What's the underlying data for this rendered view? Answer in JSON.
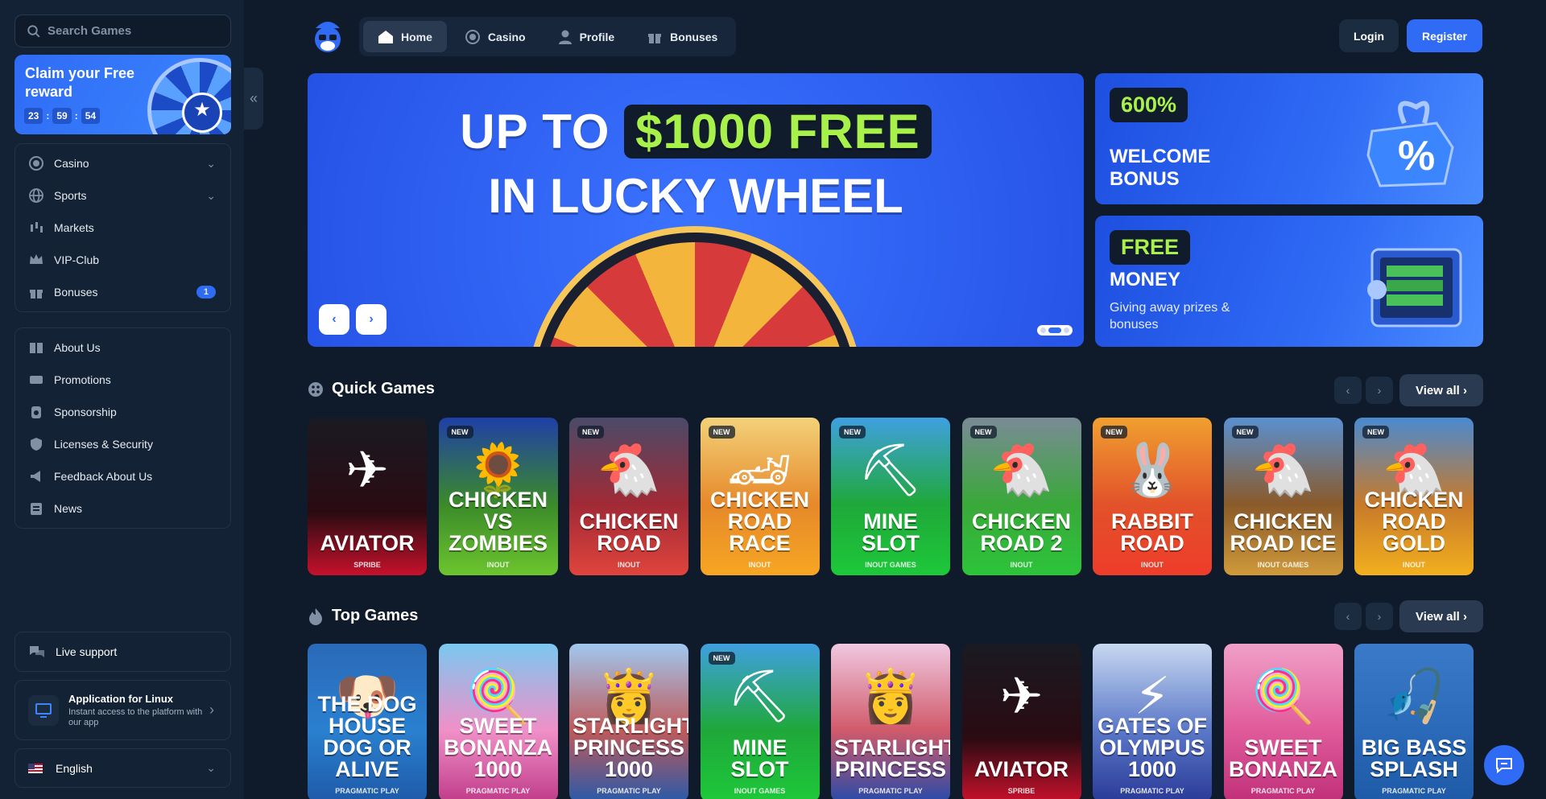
{
  "sidebar": {
    "search_placeholder": "Search Games",
    "claim": {
      "title": "Claim your Free reward",
      "hours": "23",
      "minutes": "59",
      "seconds": "54"
    },
    "nav": [
      {
        "label": "Casino",
        "icon": "casino-icon"
      },
      {
        "label": "Sports",
        "icon": "globe-icon"
      },
      {
        "label": "Markets",
        "icon": "candlestick-icon"
      },
      {
        "label": "VIP-Club",
        "icon": "crown-icon"
      },
      {
        "label": "Bonuses",
        "icon": "gift-icon",
        "badge": "1"
      }
    ],
    "info": [
      {
        "label": "About Us"
      },
      {
        "label": "Promotions"
      },
      {
        "label": "Sponsorship"
      },
      {
        "label": "Licenses & Security"
      },
      {
        "label": "Feedback About Us"
      },
      {
        "label": "News"
      }
    ],
    "live_support": "Live support",
    "app": {
      "title": "Application for Linux",
      "subtitle": "Instant access to the platform with our app"
    },
    "language": "English"
  },
  "header": {
    "tabs": [
      {
        "label": "Home",
        "active": true
      },
      {
        "label": "Casino"
      },
      {
        "label": "Profile"
      },
      {
        "label": "Bonuses"
      }
    ],
    "login": "Login",
    "register": "Register"
  },
  "hero": {
    "line1_prefix": "UP TO",
    "line1_highlight": "$1000 FREE",
    "line2": "IN LUCKY WHEEL",
    "prev": "‹",
    "next": "›"
  },
  "promos": [
    {
      "tag": "600%",
      "title": "WELCOME BONUS"
    },
    {
      "tag": "FREE",
      "title": "MONEY",
      "subtitle": "Giving away prizes & bonuses"
    }
  ],
  "quick_games": {
    "title": "Quick Games",
    "view_all": "View all",
    "games": [
      {
        "name": "AVIATOR",
        "provider": "SPRIBE",
        "new": false,
        "bg": "linear-gradient(180deg,#1a1a22,#2a0b12 60%,#c7112b)",
        "art": "✈"
      },
      {
        "name": "CHICKEN VS ZOMBIES",
        "provider": "INOUT",
        "new": true,
        "bg": "linear-gradient(180deg,#1f3fa8,#3b8a2a 55%,#6cc52e)",
        "art": "🌻"
      },
      {
        "name": "CHICKEN ROAD",
        "provider": "INOUT",
        "new": true,
        "bg": "linear-gradient(180deg,#4a4a68,#a02a36 55%,#e0443c)",
        "art": "🐔"
      },
      {
        "name": "CHICKEN ROAD RACE",
        "provider": "INOUT",
        "new": true,
        "bg": "linear-gradient(180deg,#f3d27a,#e6892a 55%,#f6a623)",
        "art": "🏎"
      },
      {
        "name": "MINE SLOT",
        "provider": "INOUT GAMES",
        "new": true,
        "bg": "linear-gradient(180deg,#3fa0e0,#1fa83a 55%,#1ec83a)",
        "art": "⛏"
      },
      {
        "name": "CHICKEN ROAD 2",
        "provider": "INOUT",
        "new": true,
        "bg": "linear-gradient(180deg,#7a8a96,#3aa83a 55%,#2cc43a)",
        "art": "🐔"
      },
      {
        "name": "RABBIT ROAD",
        "provider": "INOUT",
        "new": true,
        "bg": "linear-gradient(180deg,#f0a030,#e2522a 55%,#ee3c2a)",
        "art": "🐰"
      },
      {
        "name": "CHICKEN ROAD ICE",
        "provider": "INOUT GAMES",
        "new": true,
        "bg": "linear-gradient(180deg,#5a90d0,#8a5a2a 55%,#d09a3a)",
        "art": "🐔"
      },
      {
        "name": "CHICKEN ROAD GOLD",
        "provider": "INOUT",
        "new": true,
        "bg": "linear-gradient(180deg,#4a8ad0,#c87a2a 55%,#f2b01e)",
        "art": "🐔"
      }
    ]
  },
  "top_games": {
    "title": "Top Games",
    "view_all": "View all",
    "games": [
      {
        "name": "THE DOG HOUSE DOG OR ALIVE",
        "provider": "PRAGMATIC PLAY",
        "new": false,
        "bg": "linear-gradient(180deg,#2a6ab8,#2a80d0 55%,#1e5aa8)",
        "art": "🐶"
      },
      {
        "name": "SWEET BONANZA 1000",
        "provider": "PRAGMATIC PLAY",
        "new": false,
        "bg": "linear-gradient(180deg,#7ac8f0,#f090c8 55%,#c03c8a)",
        "art": "🍭"
      },
      {
        "name": "STARLIGHT PRINCESS 1000",
        "provider": "PRAGMATIC PLAY",
        "new": false,
        "bg": "linear-gradient(180deg,#a0c8f0,#c05a5a 55%,#2a5aa8)",
        "art": "👸"
      },
      {
        "name": "MINE SLOT",
        "provider": "INOUT GAMES",
        "new": true,
        "bg": "linear-gradient(180deg,#3fa0e0,#1fa83a 55%,#1ec83a)",
        "art": "⛏"
      },
      {
        "name": "STARLIGHT PRINCESS",
        "provider": "PRAGMATIC PLAY",
        "new": false,
        "bg": "linear-gradient(180deg,#f0c8e0,#d05a6a 55%,#2a4aa8)",
        "art": "👸"
      },
      {
        "name": "AVIATOR",
        "provider": "SPRIBE",
        "new": false,
        "bg": "linear-gradient(180deg,#1a1a22,#2a0b12 60%,#c7112b)",
        "art": "✈"
      },
      {
        "name": "GATES OF OLYMPUS 1000",
        "provider": "PRAGMATIC PLAY",
        "new": false,
        "bg": "linear-gradient(180deg,#c8d8f0,#5a78c8 55%,#2a3a98)",
        "art": "⚡"
      },
      {
        "name": "SWEET BONANZA",
        "provider": "PRAGMATIC PLAY",
        "new": false,
        "bg": "linear-gradient(180deg,#f0a0c8,#e05a9a 55%,#c0307a)",
        "art": "🍭"
      },
      {
        "name": "BIG BASS SPLASH",
        "provider": "PRAGMATIC PLAY",
        "new": false,
        "bg": "linear-gradient(180deg,#3a7ac8,#2a6ab8 55%,#1e5aa8)",
        "art": "🎣"
      }
    ]
  },
  "colors": {
    "accent": "#2f6bf5",
    "highlight": "#a8f04a",
    "bg": "#0f1b2a",
    "sidebar": "#132234"
  }
}
